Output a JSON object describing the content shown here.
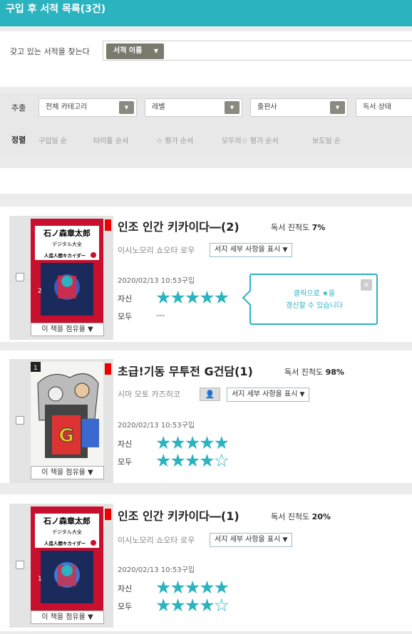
{
  "header": {
    "title": "구입 후 서적 목록(3건)"
  },
  "search": {
    "label": "갖고 있는 서적을 찾는다",
    "select_value": "서적 이름",
    "caret": "▼"
  },
  "filters": {
    "label": "추출",
    "dropdowns": [
      "전체 카테고리",
      "레벨",
      "출판사",
      "독서 상태"
    ],
    "caret": "▼",
    "sort_label": "정렬",
    "sort_options": [
      "구입일 순",
      "타이틀 순서",
      "☆ 평가 순서",
      "모두의☆ 평가 순서",
      "보도일 순"
    ]
  },
  "tooltip": {
    "line1": "클릭으로 ★을",
    "line2": "갱신할 수 있습니다",
    "close": "×"
  },
  "books": [
    {
      "title": "인조 인간 키카이다―(2)",
      "progress_label": "독서 진척도",
      "progress": "7%",
      "author": "이시노모리 쇼오타 로우",
      "detail_label": "서지 세부 사항을 표시",
      "date": "2020/02/13 10:53구입",
      "self_label": "자신",
      "all_label": "모두",
      "self_stars": "★★★★★",
      "all_stars": "---",
      "occupancy_label": "이 책을 점유율 ▼",
      "cover": {
        "title": "石ノ森章太郎",
        "sub": "デジタル大全",
        "name": "人造人間キカイダー",
        "vol": "2"
      }
    },
    {
      "title": "초급!기동 무투전 G건담(1)",
      "progress_label": "독서 진척도",
      "progress": "98%",
      "author": "시마 모토 카즈히코",
      "detail_label": "서지 세부 사항을 표시",
      "date": "2020/02/13 10:53구입",
      "self_label": "자신",
      "all_label": "모두",
      "self_stars": "★★★★★",
      "all_stars": "★★★★☆",
      "occupancy_label": "이 책을 점유율 ▼",
      "cover": {
        "vol": "1"
      }
    },
    {
      "title": "인조 인간 키카이다―(1)",
      "progress_label": "독서 진척도",
      "progress": "20%",
      "author": "이시노모리 쇼오타 로우",
      "detail_label": "서지 세부 사항을 표시",
      "date": "2020/02/13 10:53구입",
      "self_label": "자신",
      "all_label": "모두",
      "self_stars": "★★★★★",
      "all_stars": "★★★★☆",
      "occupancy_label": "이 책을 점유율 ▼",
      "cover": {
        "title": "石ノ森章太郎",
        "sub": "デジタル大全",
        "name": "人造人間キカイダー",
        "vol": "1"
      }
    }
  ],
  "colors": {
    "accent": "#2bb3c0",
    "red": "#e00000"
  }
}
